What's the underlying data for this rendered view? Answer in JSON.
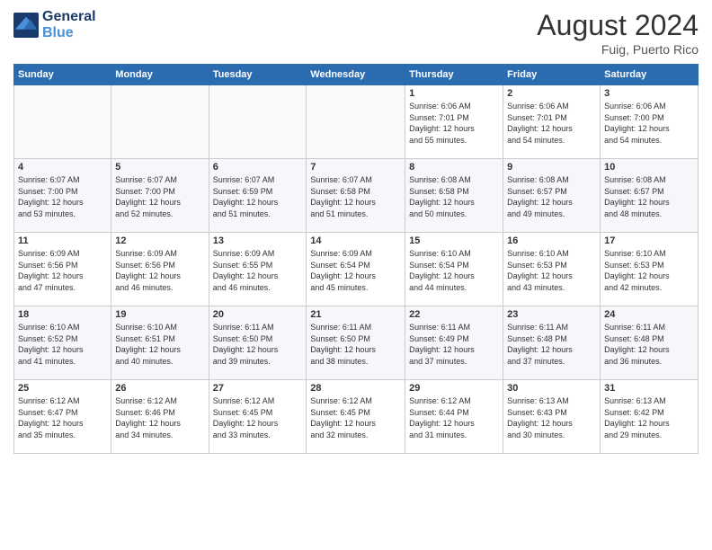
{
  "header": {
    "logo_line1": "General",
    "logo_line2": "Blue",
    "month_year": "August 2024",
    "location": "Fuig, Puerto Rico"
  },
  "weekdays": [
    "Sunday",
    "Monday",
    "Tuesday",
    "Wednesday",
    "Thursday",
    "Friday",
    "Saturday"
  ],
  "weeks": [
    [
      {
        "day": "",
        "info": ""
      },
      {
        "day": "",
        "info": ""
      },
      {
        "day": "",
        "info": ""
      },
      {
        "day": "",
        "info": ""
      },
      {
        "day": "1",
        "info": "Sunrise: 6:06 AM\nSunset: 7:01 PM\nDaylight: 12 hours\nand 55 minutes."
      },
      {
        "day": "2",
        "info": "Sunrise: 6:06 AM\nSunset: 7:01 PM\nDaylight: 12 hours\nand 54 minutes."
      },
      {
        "day": "3",
        "info": "Sunrise: 6:06 AM\nSunset: 7:00 PM\nDaylight: 12 hours\nand 54 minutes."
      }
    ],
    [
      {
        "day": "4",
        "info": "Sunrise: 6:07 AM\nSunset: 7:00 PM\nDaylight: 12 hours\nand 53 minutes."
      },
      {
        "day": "5",
        "info": "Sunrise: 6:07 AM\nSunset: 7:00 PM\nDaylight: 12 hours\nand 52 minutes."
      },
      {
        "day": "6",
        "info": "Sunrise: 6:07 AM\nSunset: 6:59 PM\nDaylight: 12 hours\nand 51 minutes."
      },
      {
        "day": "7",
        "info": "Sunrise: 6:07 AM\nSunset: 6:58 PM\nDaylight: 12 hours\nand 51 minutes."
      },
      {
        "day": "8",
        "info": "Sunrise: 6:08 AM\nSunset: 6:58 PM\nDaylight: 12 hours\nand 50 minutes."
      },
      {
        "day": "9",
        "info": "Sunrise: 6:08 AM\nSunset: 6:57 PM\nDaylight: 12 hours\nand 49 minutes."
      },
      {
        "day": "10",
        "info": "Sunrise: 6:08 AM\nSunset: 6:57 PM\nDaylight: 12 hours\nand 48 minutes."
      }
    ],
    [
      {
        "day": "11",
        "info": "Sunrise: 6:09 AM\nSunset: 6:56 PM\nDaylight: 12 hours\nand 47 minutes."
      },
      {
        "day": "12",
        "info": "Sunrise: 6:09 AM\nSunset: 6:56 PM\nDaylight: 12 hours\nand 46 minutes."
      },
      {
        "day": "13",
        "info": "Sunrise: 6:09 AM\nSunset: 6:55 PM\nDaylight: 12 hours\nand 46 minutes."
      },
      {
        "day": "14",
        "info": "Sunrise: 6:09 AM\nSunset: 6:54 PM\nDaylight: 12 hours\nand 45 minutes."
      },
      {
        "day": "15",
        "info": "Sunrise: 6:10 AM\nSunset: 6:54 PM\nDaylight: 12 hours\nand 44 minutes."
      },
      {
        "day": "16",
        "info": "Sunrise: 6:10 AM\nSunset: 6:53 PM\nDaylight: 12 hours\nand 43 minutes."
      },
      {
        "day": "17",
        "info": "Sunrise: 6:10 AM\nSunset: 6:53 PM\nDaylight: 12 hours\nand 42 minutes."
      }
    ],
    [
      {
        "day": "18",
        "info": "Sunrise: 6:10 AM\nSunset: 6:52 PM\nDaylight: 12 hours\nand 41 minutes."
      },
      {
        "day": "19",
        "info": "Sunrise: 6:10 AM\nSunset: 6:51 PM\nDaylight: 12 hours\nand 40 minutes."
      },
      {
        "day": "20",
        "info": "Sunrise: 6:11 AM\nSunset: 6:50 PM\nDaylight: 12 hours\nand 39 minutes."
      },
      {
        "day": "21",
        "info": "Sunrise: 6:11 AM\nSunset: 6:50 PM\nDaylight: 12 hours\nand 38 minutes."
      },
      {
        "day": "22",
        "info": "Sunrise: 6:11 AM\nSunset: 6:49 PM\nDaylight: 12 hours\nand 37 minutes."
      },
      {
        "day": "23",
        "info": "Sunrise: 6:11 AM\nSunset: 6:48 PM\nDaylight: 12 hours\nand 37 minutes."
      },
      {
        "day": "24",
        "info": "Sunrise: 6:11 AM\nSunset: 6:48 PM\nDaylight: 12 hours\nand 36 minutes."
      }
    ],
    [
      {
        "day": "25",
        "info": "Sunrise: 6:12 AM\nSunset: 6:47 PM\nDaylight: 12 hours\nand 35 minutes."
      },
      {
        "day": "26",
        "info": "Sunrise: 6:12 AM\nSunset: 6:46 PM\nDaylight: 12 hours\nand 34 minutes."
      },
      {
        "day": "27",
        "info": "Sunrise: 6:12 AM\nSunset: 6:45 PM\nDaylight: 12 hours\nand 33 minutes."
      },
      {
        "day": "28",
        "info": "Sunrise: 6:12 AM\nSunset: 6:45 PM\nDaylight: 12 hours\nand 32 minutes."
      },
      {
        "day": "29",
        "info": "Sunrise: 6:12 AM\nSunset: 6:44 PM\nDaylight: 12 hours\nand 31 minutes."
      },
      {
        "day": "30",
        "info": "Sunrise: 6:13 AM\nSunset: 6:43 PM\nDaylight: 12 hours\nand 30 minutes."
      },
      {
        "day": "31",
        "info": "Sunrise: 6:13 AM\nSunset: 6:42 PM\nDaylight: 12 hours\nand 29 minutes."
      }
    ]
  ]
}
